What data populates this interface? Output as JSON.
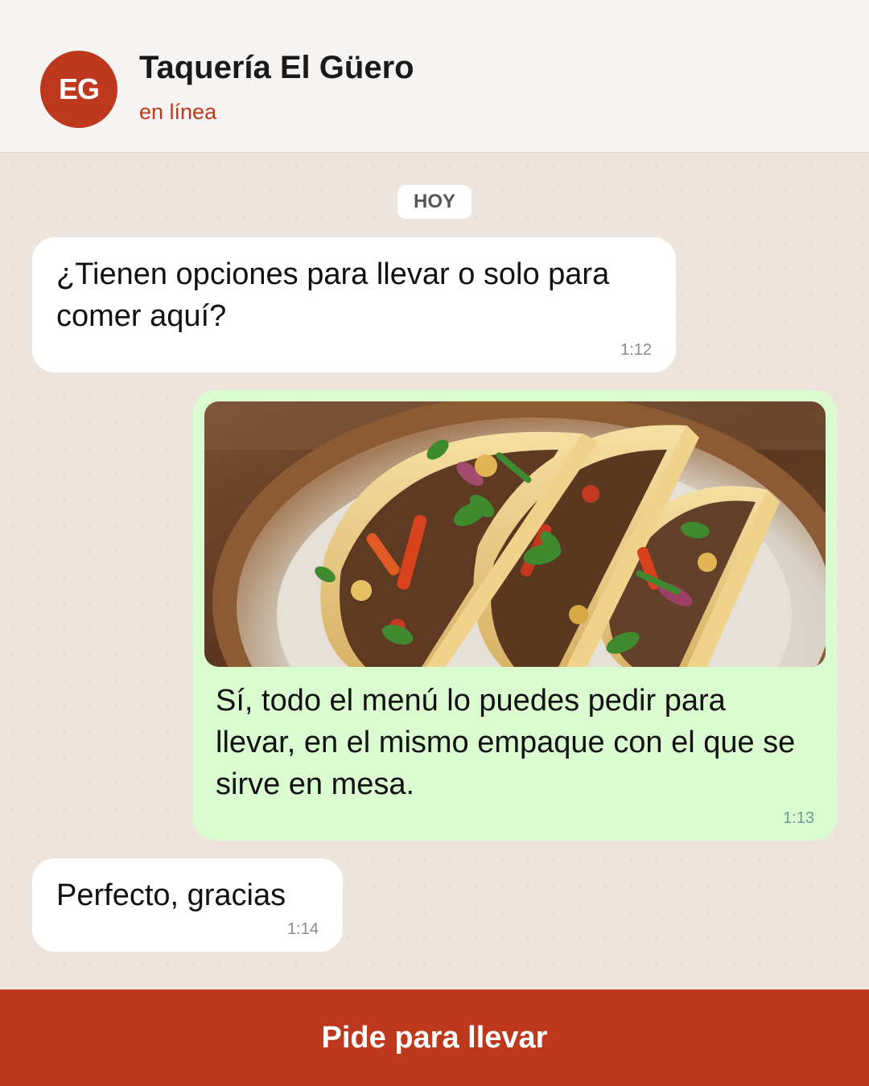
{
  "contact": {
    "initials": "EG",
    "name": "Taquería El Güero",
    "status": "en línea"
  },
  "date_label": "HOY",
  "messages": [
    {
      "direction": "incoming",
      "text": "¿Tienen opciones para llevar o solo para comer aquí?",
      "time": "1:12"
    },
    {
      "direction": "outgoing",
      "image": "tacos-photo",
      "text": "Sí, todo el menú lo puedes pedir para llevar, en el mismo empaque con el que se sirve en mesa.",
      "time": "1:13"
    },
    {
      "direction": "incoming",
      "text": "Perfecto, gracias",
      "time": "1:14"
    }
  ],
  "cta": {
    "label": "Pide para llevar"
  },
  "colors": {
    "accent": "#bd381c",
    "header_bg": "#f6f4f2",
    "chat_bg": "#ede5dd",
    "incoming_bubble": "#ffffff",
    "outgoing_bubble": "#dafad0"
  }
}
